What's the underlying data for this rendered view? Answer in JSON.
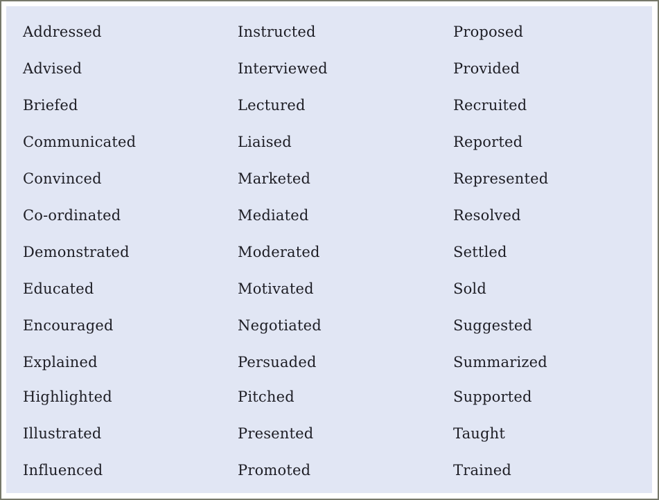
{
  "columns": [
    [
      "Addressed",
      "Advised",
      "Briefed",
      "Communicated",
      "Convinced",
      "Co-ordinated",
      "Demonstrated",
      "Educated",
      "Encouraged",
      "Explained",
      "Highlighted",
      "Illustrated",
      "Influenced"
    ],
    [
      "Instructed",
      "Interviewed",
      "Lectured",
      "Liaised",
      "Marketed",
      "Mediated",
      "Moderated",
      "Motivated",
      "Negotiated",
      "Persuaded",
      "Pitched",
      "Presented",
      "Promoted"
    ],
    [
      "Proposed",
      "Provided",
      "Recruited",
      "Reported",
      "Represented",
      "Resolved",
      "Settled",
      "Sold",
      "Suggested",
      "Summarized",
      "Supported",
      "Taught",
      "Trained"
    ]
  ]
}
